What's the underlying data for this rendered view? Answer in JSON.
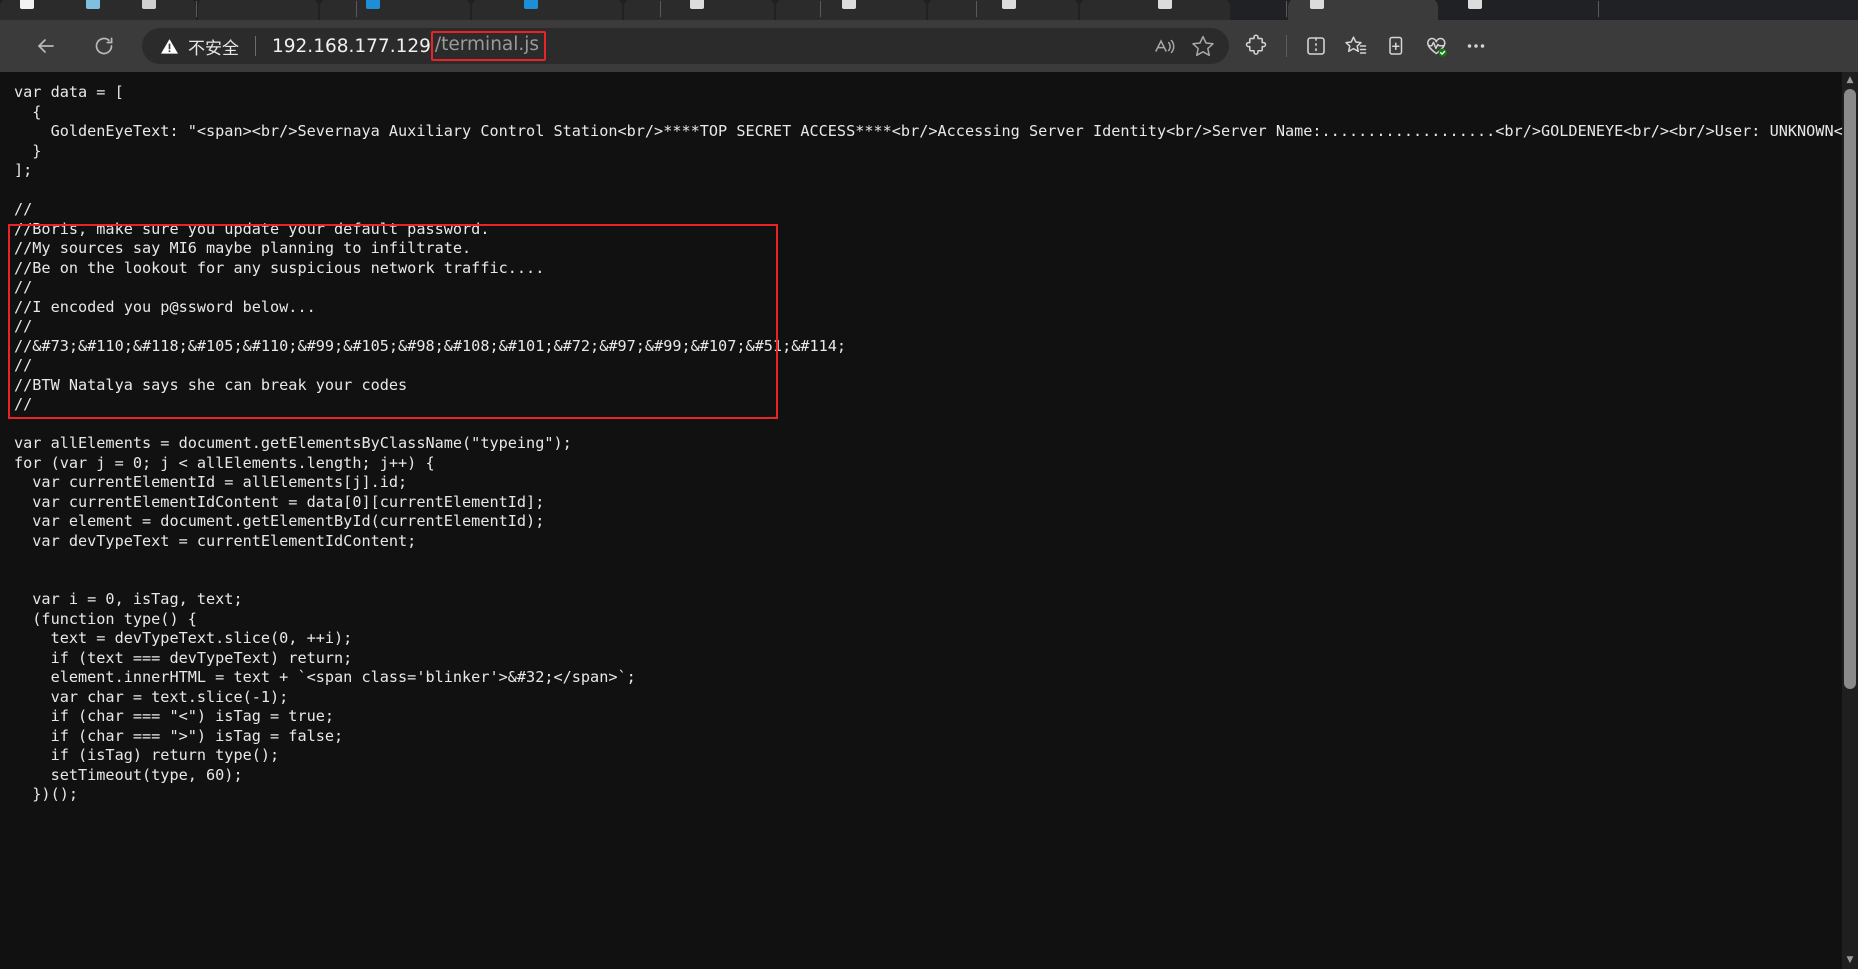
{
  "browser": {
    "back_label": "Back",
    "reload_label": "Refresh",
    "security": {
      "icon": "warning-triangle-icon",
      "label": "不安全"
    },
    "url": {
      "host": "192.168.177.129",
      "path": "/terminal.js",
      "highlight_color": "#e8232a"
    },
    "omnibox_actions": [
      {
        "name": "read-aloud-icon",
        "label": "朗读此页面"
      },
      {
        "name": "favorite-star-icon",
        "label": "将此页面添加到收藏夹"
      }
    ],
    "toolbar_actions": [
      {
        "name": "extensions-icon",
        "label": "扩展"
      },
      {
        "name": "split-screen-icon",
        "label": "拆分屏幕"
      },
      {
        "name": "collections-icon",
        "label": "集锦"
      },
      {
        "name": "add-to-favorites-icon",
        "label": "添加到收藏夹"
      },
      {
        "name": "browser-essentials-icon",
        "label": "浏览器基本功能"
      },
      {
        "name": "settings-and-more-icon",
        "label": "设置及其他"
      }
    ]
  },
  "annotation": {
    "box_color": "#e8232a",
    "box_name": "comment-block-highlight"
  },
  "page": {
    "filename": "terminal.js",
    "code": "var data = [\n  {\n    GoldenEyeText: \"<span><br/>Severnaya Auxiliary Control Station<br/>****TOP SECRET ACCESS****<br/>Accessing Server Identity<br/>Server Name:...................<br/>GOLDENEYE<br/><br/>User: UNKNOWN<br/><span>Naviagate to /sev-home/ to login</span>\"\n  }\n];\n\n//\n//Boris, make sure you update your default password.\n//My sources say MI6 maybe planning to infiltrate.\n//Be on the lookout for any suspicious network traffic....\n//\n//I encoded you p@ssword below...\n//\n//&#73;&#110;&#118;&#105;&#110;&#99;&#105;&#98;&#108;&#101;&#72;&#97;&#99;&#107;&#51;&#114;\n//\n//BTW Natalya says she can break your codes\n//\n\nvar allElements = document.getElementsByClassName(\"typeing\");\nfor (var j = 0; j < allElements.length; j++) {\n  var currentElementId = allElements[j].id;\n  var currentElementIdContent = data[0][currentElementId];\n  var element = document.getElementById(currentElementId);\n  var devTypeText = currentElementIdContent;\n\n\n  var i = 0, isTag, text;\n  (function type() {\n    text = devTypeText.slice(0, ++i);\n    if (text === devTypeText) return;\n    element.innerHTML = text + `<span class='blinker'>&#32;</span>`;\n    var char = text.slice(-1);\n    if (char === \"<\") isTag = true;\n    if (char === \">\") isTag = false;\n    if (isTag) return type();\n    setTimeout(type, 60);\n  })();"
  },
  "scrollbar": {
    "up_arrow": "▲",
    "down_arrow": "▼"
  }
}
